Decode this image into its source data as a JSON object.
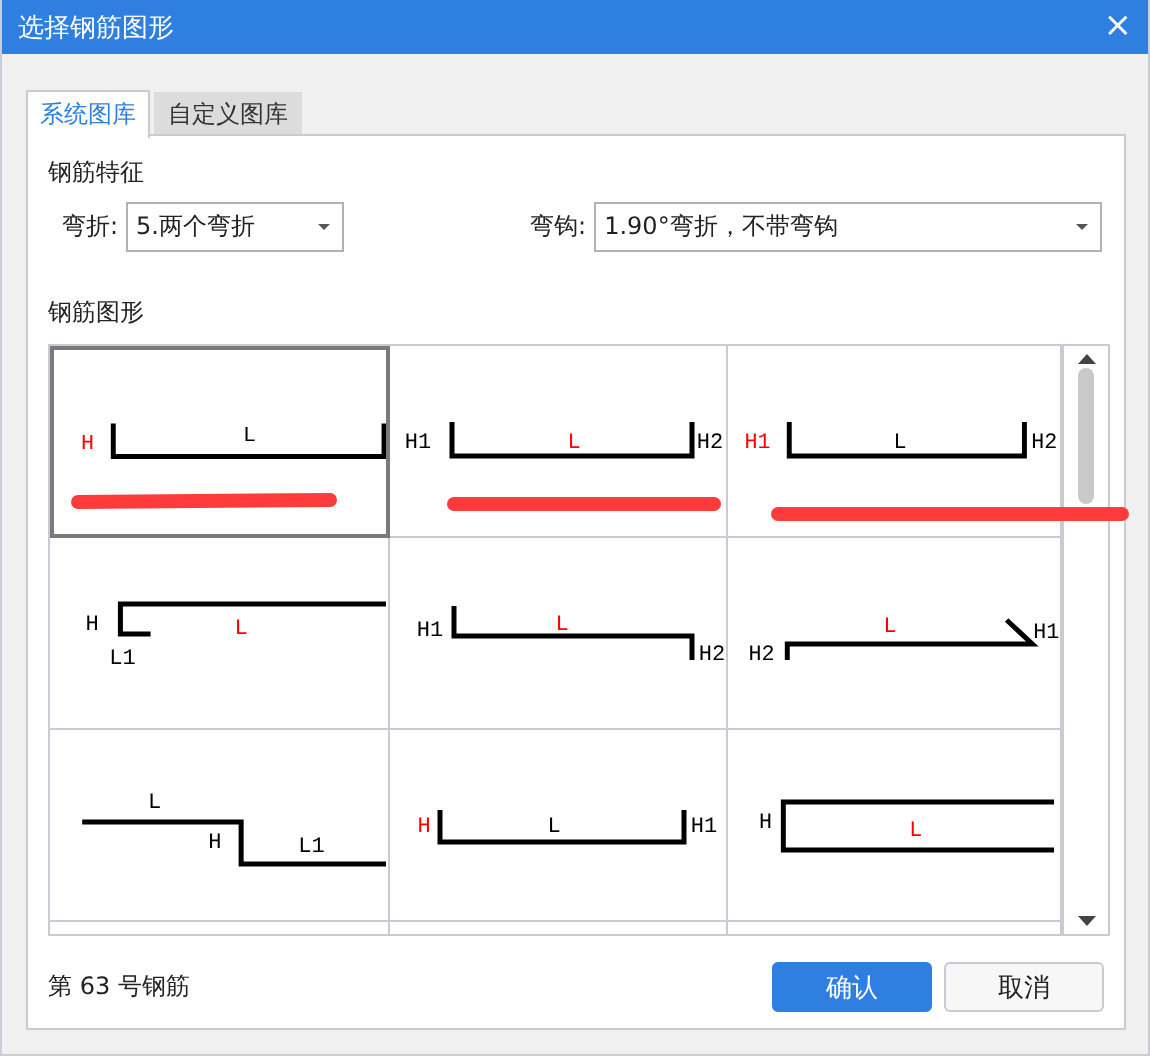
{
  "window": {
    "title": "选择钢筋图形",
    "close": "×"
  },
  "tabs": [
    {
      "label": "系统图库",
      "selected": true
    },
    {
      "label": "自定义图库",
      "selected": false
    }
  ],
  "features": {
    "heading": "钢筋特征",
    "bend": {
      "label": "弯折:",
      "value": "5.两个弯折"
    },
    "hook": {
      "label": "弯钩:",
      "value": "1.90°弯折，不带弯钩"
    }
  },
  "shapes": {
    "heading": "钢筋图形",
    "cells": [
      {
        "kind": "u-flat",
        "selected": true,
        "labels": [
          {
            "text": "H",
            "highlighted": true
          },
          {
            "text": "L",
            "highlighted": false
          }
        ]
      },
      {
        "kind": "u-two",
        "selected": false,
        "labels": [
          {
            "text": "H1",
            "highlighted": false
          },
          {
            "text": "L",
            "highlighted": true
          },
          {
            "text": "H2",
            "highlighted": false
          }
        ]
      },
      {
        "kind": "u-two-b",
        "selected": false,
        "labels": [
          {
            "text": "H1",
            "highlighted": true
          },
          {
            "text": "L",
            "highlighted": false
          },
          {
            "text": "H2",
            "highlighted": false
          }
        ]
      },
      {
        "kind": "hook-back",
        "selected": false,
        "labels": [
          {
            "text": "H",
            "highlighted": false
          },
          {
            "text": "L",
            "highlighted": true
          },
          {
            "text": "L1",
            "highlighted": false
          }
        ]
      },
      {
        "kind": "z-bend",
        "selected": false,
        "labels": [
          {
            "text": "H1",
            "highlighted": false
          },
          {
            "text": "L",
            "highlighted": true
          },
          {
            "text": "H2",
            "highlighted": false
          }
        ]
      },
      {
        "kind": "angled-end",
        "selected": false,
        "labels": [
          {
            "text": "H2",
            "highlighted": false
          },
          {
            "text": "L",
            "highlighted": true
          },
          {
            "text": "H1",
            "highlighted": false
          }
        ]
      },
      {
        "kind": "step",
        "selected": false,
        "labels": [
          {
            "text": "L",
            "highlighted": false
          },
          {
            "text": "H",
            "highlighted": false
          },
          {
            "text": "L1",
            "highlighted": false
          }
        ]
      },
      {
        "kind": "u-wide",
        "selected": false,
        "labels": [
          {
            "text": "H",
            "highlighted": true
          },
          {
            "text": "L",
            "highlighted": false
          },
          {
            "text": "H1",
            "highlighted": false
          }
        ]
      },
      {
        "kind": "c-open",
        "selected": false,
        "labels": [
          {
            "text": "H",
            "highlighted": false
          },
          {
            "text": "L",
            "highlighted": true
          }
        ]
      }
    ]
  },
  "footer": {
    "status": "第 63 号钢筋",
    "buttons": [
      {
        "label": "确认",
        "kind": "primary"
      },
      {
        "label": "取消",
        "kind": "secondary"
      }
    ]
  }
}
